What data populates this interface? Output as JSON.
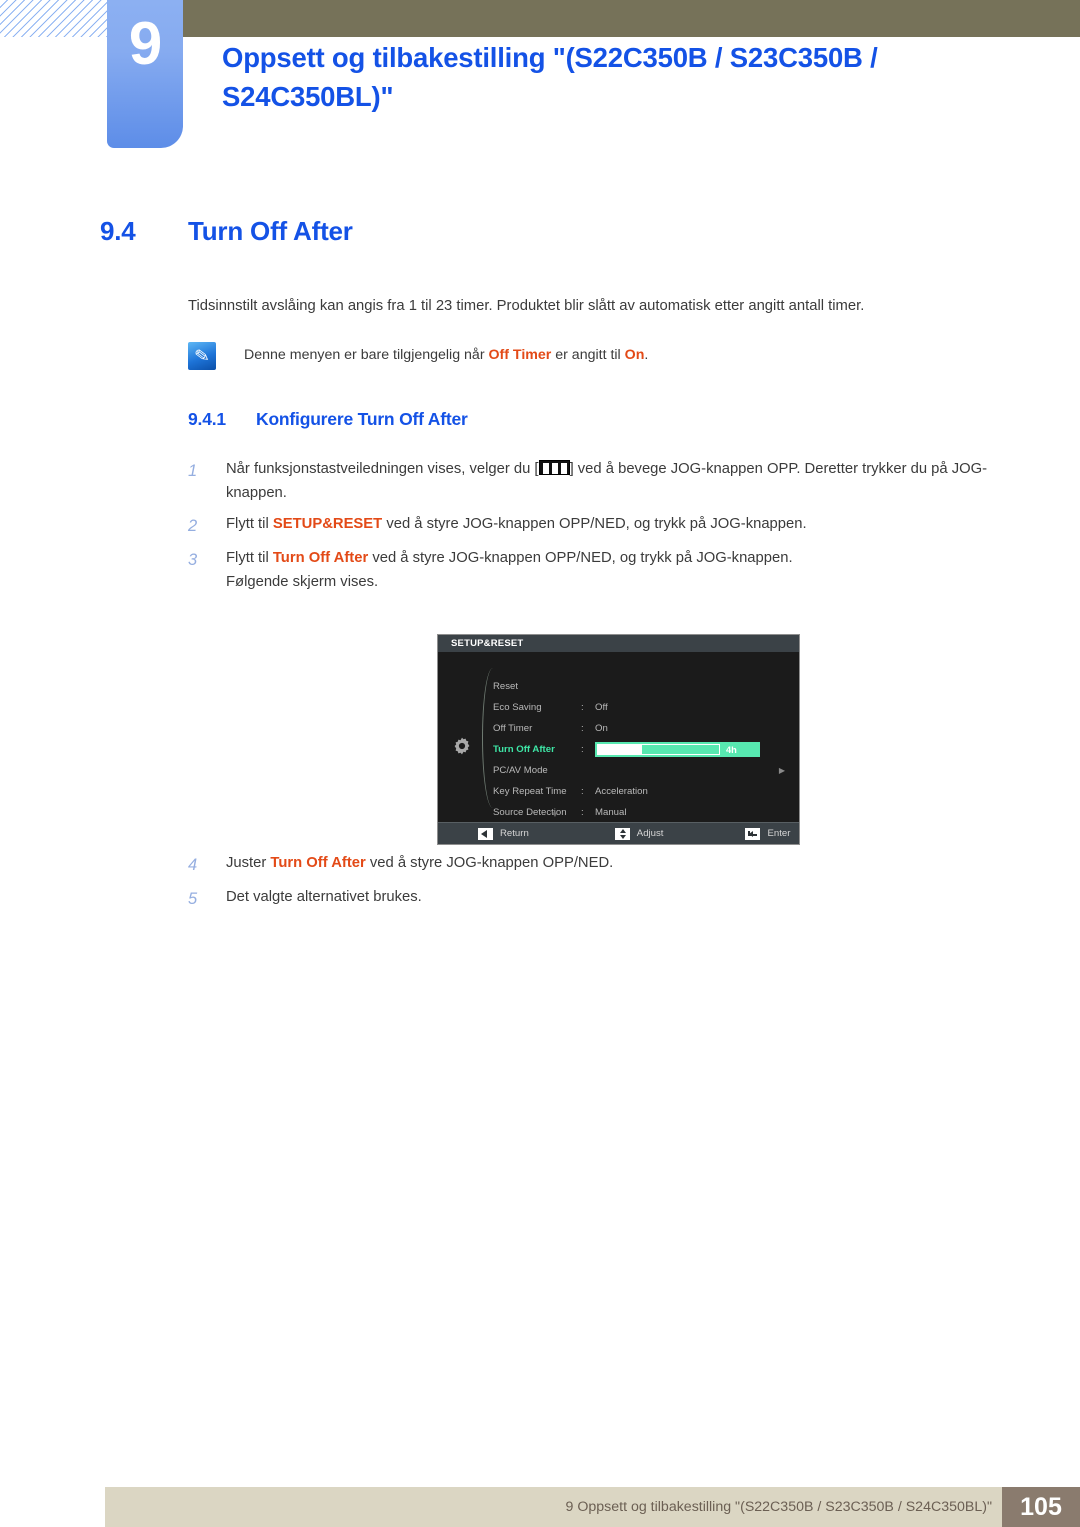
{
  "chapter": {
    "number": "9",
    "title": "Oppsett og tilbakestilling \"(S22C350B / S23C350B / S24C350BL)\"",
    "tab_color": "#86abf0",
    "bar_color": "#767259",
    "title_color": "#1452e6"
  },
  "section": {
    "number": "9.4",
    "title": "Turn Off After",
    "intro": "Tidsinnstilt avslåing kan angis fra 1 til 23 timer. Produktet blir slått av automatisk etter angitt antall timer."
  },
  "note": {
    "icon": "note-pencil-icon",
    "prefix": "Denne menyen er bare tilgjengelig når ",
    "term1": "Off Timer",
    "middle": " er angitt til ",
    "term2": "On",
    "suffix": ".",
    "highlight_color": "#e34a17"
  },
  "subsection": {
    "number": "9.4.1",
    "title": "Konfigurere Turn Off After"
  },
  "steps": [
    {
      "num": "1",
      "parts": [
        {
          "t": "Når funksjonstastveiledningen vises, velger du [",
          "s": "plain"
        },
        {
          "t": "",
          "s": "menu-key-icon"
        },
        {
          "t": "] ved å bevege JOG-knappen OPP. Deretter trykker du på JOG-knappen.",
          "s": "plain"
        }
      ]
    },
    {
      "num": "2",
      "parts": [
        {
          "t": "Flytt til ",
          "s": "plain"
        },
        {
          "t": "SETUP&RESET",
          "s": "orange"
        },
        {
          "t": " ved å styre JOG-knappen OPP/NED, og trykk på JOG-knappen.",
          "s": "plain"
        }
      ]
    },
    {
      "num": "3",
      "parts": [
        {
          "t": "Flytt til ",
          "s": "plain"
        },
        {
          "t": "Turn Off After",
          "s": "orange"
        },
        {
          "t": " ved å styre JOG-knappen OPP/NED, og trykk på JOG-knappen.",
          "s": "plain"
        },
        {
          "t": "Følgende skjerm vises.",
          "s": "newline"
        }
      ]
    }
  ],
  "steps_after": [
    {
      "num": "4",
      "parts": [
        {
          "t": "Juster ",
          "s": "plain"
        },
        {
          "t": "Turn Off After",
          "s": "orange"
        },
        {
          "t": " ved å styre JOG-knappen OPP/NED.",
          "s": "plain"
        }
      ]
    },
    {
      "num": "5",
      "parts": [
        {
          "t": "Det valgte alternativet brukes.",
          "s": "plain"
        }
      ]
    }
  ],
  "osd": {
    "title": "SETUP&RESET",
    "gear_icon": "gear-icon",
    "rows": [
      {
        "label": "Reset",
        "colon": "",
        "value": "",
        "type": "text",
        "active": false
      },
      {
        "label": "Eco Saving",
        "colon": ":",
        "value": "Off",
        "type": "text",
        "active": false
      },
      {
        "label": "Off Timer",
        "colon": ":",
        "value": "On",
        "type": "text",
        "active": false
      },
      {
        "label": "Turn Off After",
        "colon": ":",
        "value": "4h",
        "type": "slider",
        "active": true,
        "fill_percent": 36
      },
      {
        "label": "PC/AV Mode",
        "colon": "",
        "value": "",
        "type": "submenu",
        "active": false
      },
      {
        "label": "Key Repeat Time",
        "colon": ":",
        "value": "Acceleration",
        "type": "text",
        "active": false
      },
      {
        "label": "Source Detection",
        "colon": ":",
        "value": "Manual",
        "type": "text",
        "active": false
      }
    ],
    "scroll_down_icon": "chevron-down-icon",
    "footer": [
      {
        "icon": "left-arrow-icon",
        "label": "Return"
      },
      {
        "icon": "up-down-arrow-icon",
        "label": "Adjust"
      },
      {
        "icon": "enter-key-icon",
        "label": "Enter"
      }
    ],
    "highlight_color": "#3ee6a6",
    "slider_color": "#57e8b0"
  },
  "page_footer": {
    "text": "9 Oppsett og tilbakestilling \"(S22C350B / S23C350B / S24C350BL)\"",
    "page_number": "105",
    "bar_color": "#dbd6c3",
    "page_block_color": "#8a7b6e"
  }
}
